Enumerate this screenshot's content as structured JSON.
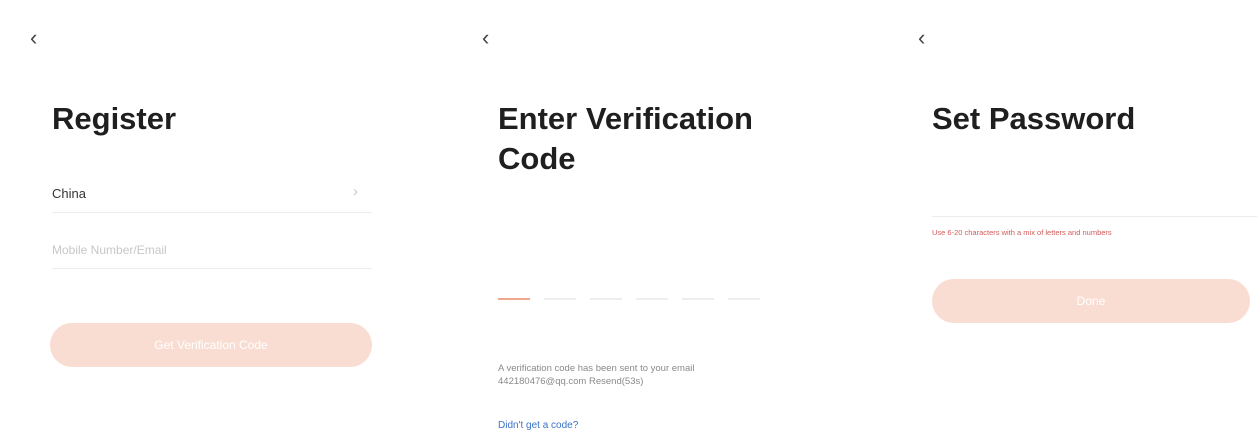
{
  "screens": {
    "register": {
      "back_icon": "chevron-left-icon",
      "title": "Register",
      "country": "China",
      "country_chevron": "chevron-right-icon",
      "account_placeholder": "Mobile Number/Email",
      "get_code_button": "Get Verification Code",
      "button_color": "#f9ddd2"
    },
    "verify": {
      "back_icon": "chevron-left-icon",
      "title": "Enter Verification Code",
      "code_slots": 6,
      "active_slot_color": "#f0a88c",
      "message": "A verification code has been sent to your email",
      "email": "442180476@qq.com",
      "resend": "Resend(53s)",
      "didnt_get_link": "Didn't get a code?",
      "link_color": "#3a73c7"
    },
    "password": {
      "back_icon": "chevron-left-icon",
      "title": "Set Password",
      "hint": "Use 6-20 characters with a mix of letters and numbers",
      "hint_color": "#d25a5a",
      "done_button": "Done",
      "button_color": "#f9ddd2"
    }
  }
}
